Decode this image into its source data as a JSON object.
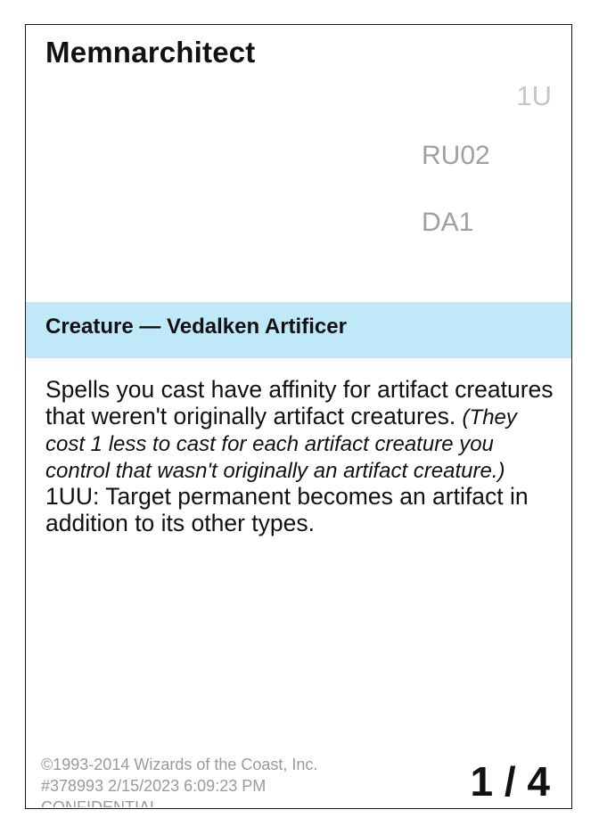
{
  "card": {
    "name": "Memnarchitect",
    "mana_cost": "1U",
    "codes": [
      "RU02",
      "DA1"
    ],
    "type_line": "Creature — Vedalken Artificer",
    "rules": {
      "line1_text": "Spells you cast have affinity for artifact creatures that weren't originally artifact creatures. ",
      "line1_reminder": "(They cost 1 less to cast for each artifact creature you control that wasn't originally an artifact creature.)",
      "line2_text": "1UU: Target permanent becomes an artifact in addition to its other types."
    },
    "legal": {
      "copyright": "©1993-2014 Wizards of the Coast, Inc.",
      "stamp": "#378993 2/15/2023 6:09:23 PM",
      "confidential": "CONFIDENTIAL"
    },
    "page_count": "1 / 4"
  },
  "colors": {
    "type_bar": "#bfe9f8",
    "mana_cost": "#c6c6c6",
    "codes": "#a0a0a0",
    "legal": "#9a9a9a",
    "text": "#111111"
  }
}
